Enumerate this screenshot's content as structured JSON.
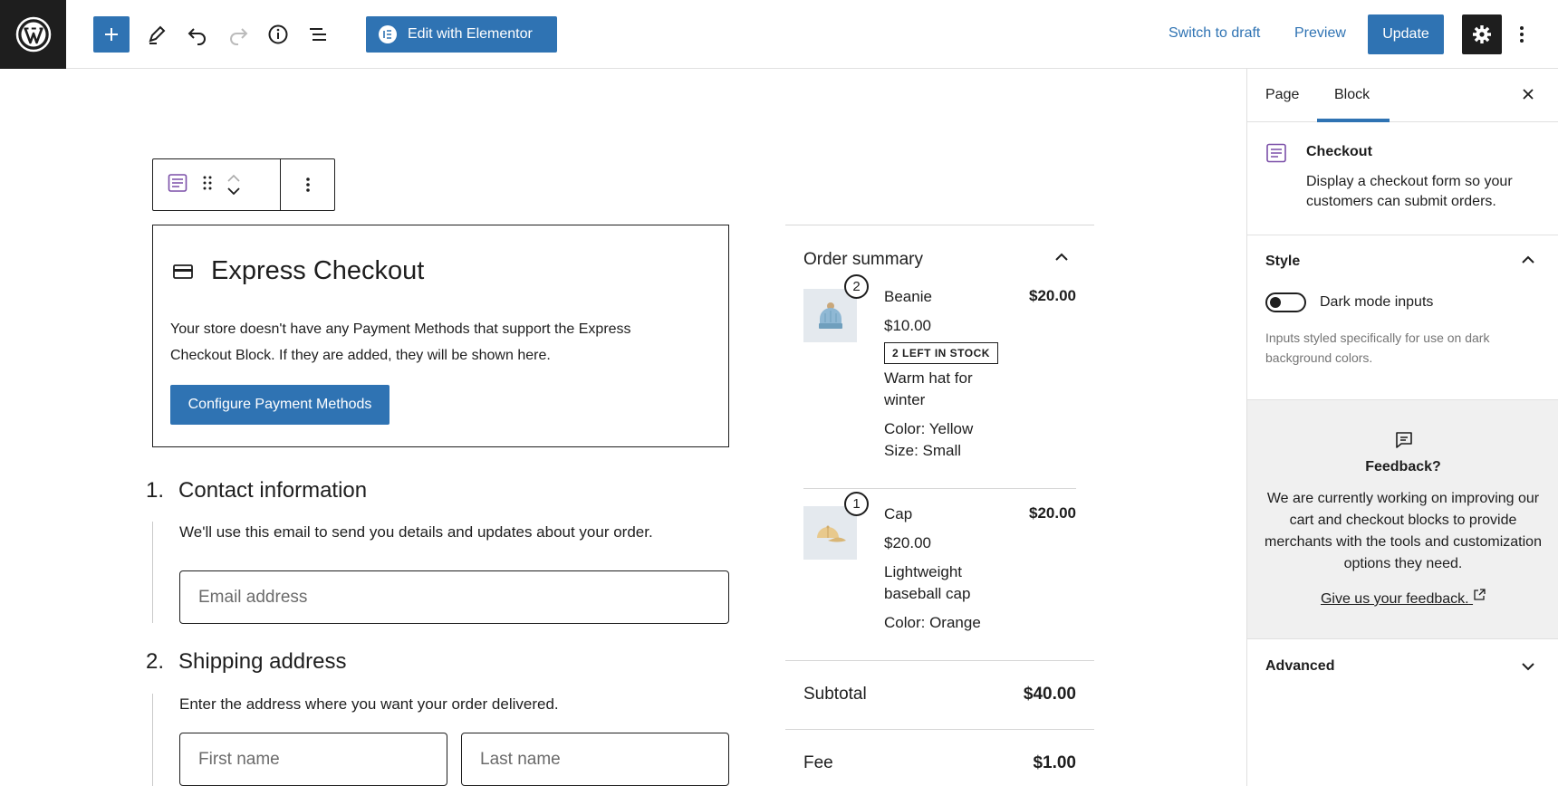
{
  "topbar": {
    "elementor_label": "Edit with Elementor",
    "switch_draft": "Switch to draft",
    "preview": "Preview",
    "update": "Update"
  },
  "express": {
    "title": "Express Checkout",
    "text": "Your store doesn't have any Payment Methods that support the Express Checkout Block. If they are added, they will be shown here.",
    "button": "Configure Payment Methods"
  },
  "contact": {
    "number": "1.",
    "title": "Contact information",
    "desc": "We'll use this email to send you details and updates about your order.",
    "email_placeholder": "Email address"
  },
  "shipping": {
    "number": "2.",
    "title": "Shipping address",
    "desc": "Enter the address where you want your order delivered.",
    "first_name": "First name",
    "last_name": "Last name"
  },
  "summary": {
    "title": "Order summary",
    "items": [
      {
        "qty": "2",
        "name": "Beanie",
        "unit_price": "$10.00",
        "stock": "2 LEFT IN STOCK",
        "desc": "Warm hat for winter",
        "attr1": "Color: Yellow",
        "attr2": "Size: Small",
        "total": "$20.00"
      },
      {
        "qty": "1",
        "name": "Cap",
        "unit_price": "$20.00",
        "desc": "Lightweight baseball cap",
        "attr1": "Color: Orange",
        "total": "$20.00"
      }
    ],
    "subtotal_label": "Subtotal",
    "subtotal": "$40.00",
    "fee_label": "Fee",
    "fee": "$1.00"
  },
  "sidebar": {
    "tab_page": "Page",
    "tab_block": "Block",
    "block_title": "Checkout",
    "block_desc": "Display a checkout form so your customers can submit orders.",
    "style_title": "Style",
    "toggle_label": "Dark mode inputs",
    "toggle_help": "Inputs styled specifically for use on dark background colors.",
    "feedback_title": "Feedback?",
    "feedback_text": "We are currently working on improving our cart and checkout blocks to provide merchants with the tools and customization options they need.",
    "feedback_link": "Give us your feedback.",
    "advanced_title": "Advanced"
  }
}
